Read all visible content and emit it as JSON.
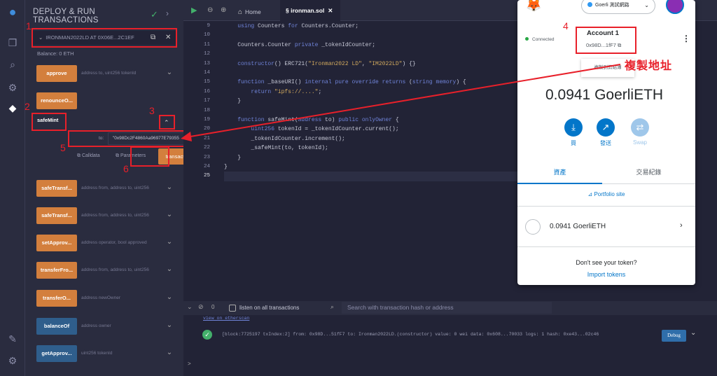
{
  "deploy": {
    "title": "DEPLOY & RUN TRANSACTIONS",
    "contract_label": "IRONMAN2022LD AT 0X06E...2C1EF",
    "balance": "Balance: 0 ETH",
    "functions": [
      {
        "label": "approve",
        "placeholder": "address to, uint256 tokenId",
        "color": "orange"
      },
      {
        "label": "renounceO...",
        "placeholder": "",
        "color": "orange"
      },
      {
        "label": "safeTransf...",
        "placeholder": "address from, address to, uint256",
        "color": "orange"
      },
      {
        "label": "safeTransf...",
        "placeholder": "address from, address to, uint256",
        "color": "orange"
      },
      {
        "label": "setApprov...",
        "placeholder": "address operator, bool approved",
        "color": "orange"
      },
      {
        "label": "transferFro...",
        "placeholder": "address from, address to, uint256",
        "color": "orange"
      },
      {
        "label": "transferO...",
        "placeholder": "address newOwner",
        "color": "orange"
      },
      {
        "label": "balanceOf",
        "placeholder": "address owner",
        "color": "blue"
      },
      {
        "label": "getApprov...",
        "placeholder": "uint256 tokenId",
        "color": "blue"
      }
    ],
    "safemint": {
      "label": "safeMint",
      "to_label": "to:",
      "to_value": "\"0x98Dc2F4860Aa96977E79355",
      "calldata": "Calldata",
      "parameters": "Parameters",
      "transact": "transact"
    }
  },
  "annotations": [
    "1",
    "2",
    "3",
    "4",
    "5",
    "6"
  ],
  "annotation_copy": "複製地址",
  "editor": {
    "home": "Home",
    "file_tab": "ironman.sol",
    "line_numbers": [
      "9",
      "10",
      "11",
      "12",
      "13",
      "14",
      "15",
      "16",
      "17",
      "18",
      "19",
      "20",
      "21",
      "22",
      "23",
      "24",
      "25"
    ],
    "lines": [
      "    using Counters for Counters.Counter;",
      "",
      "    Counters.Counter private _tokenIdCounter;",
      "",
      "    constructor() ERC721(\"Ironman2022 LD\", \"IM2022LD\") {}",
      "",
      "    function _baseURI() internal pure override returns (string memory) {",
      "        return \"ipfs://....\";",
      "    }",
      "",
      "    function safeMint(address to) public onlyOwner {",
      "        uint256 tokenId = _tokenIdCounter.current();",
      "        _tokenIdCounter.increment();",
      "        _safeMint(to, tokenId);",
      "    }",
      "}",
      ""
    ]
  },
  "terminal": {
    "count": "0",
    "listen": "listen on all transactions",
    "search_placeholder": "Search with transaction hash or address",
    "etherscan": "view on etherscan",
    "tx_line": "[block:7725197 txIndex:2]  from: 0x98D...51fF7 to: Ironman2022LD.(constructor) value: 0 wei data: 0x608...70033 logs: 1 hash: 0xe43...02c46",
    "debug": "Debug",
    "prompt": ">"
  },
  "metamask": {
    "network": "Goerli 測試網路",
    "connected": "Connected",
    "account_name": "Account 1",
    "account_addr": "0x98D...1fF7",
    "copy_tooltip": "複製到剪貼簿",
    "balance": "0.0941 GoerliETH",
    "actions": [
      {
        "label": "買",
        "icon": "download-icon"
      },
      {
        "label": "發送",
        "icon": "send-arrow-icon"
      },
      {
        "label": "Swap",
        "icon": "swap-icon"
      }
    ],
    "tab_assets": "資產",
    "tab_activity": "交易紀錄",
    "portfolio": "Portfolio site",
    "token_value": "0.0941 GoerliETH",
    "dont_see": "Don't see your token?",
    "import": "Import tokens"
  },
  "colors": {
    "accent_orange": "#d37f3d",
    "accent_blue": "#2f5e8c",
    "annotation_red": "#e8202a",
    "metamask_blue": "#0376c9"
  }
}
